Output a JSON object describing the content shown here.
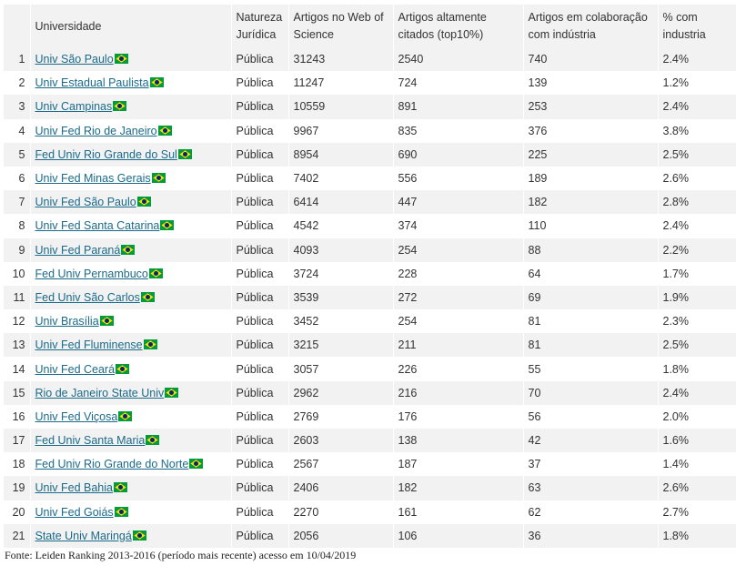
{
  "table": {
    "headers": {
      "rank": "",
      "universidade": "Universidade",
      "natureza": "Natureza Jurídica",
      "artigos_wos": "Artigos no Web of Science",
      "altamente_citados": "Artigos altamente citados (top10%)",
      "colab_industria": "Artigos em colaboração com indústria",
      "pct_industria": "% com industria"
    },
    "rows": [
      {
        "rank": "1",
        "name": "Univ São Paulo",
        "nature": "Pública",
        "wos": "31243",
        "top10": "2540",
        "industry": "740",
        "pct": "2.4%"
      },
      {
        "rank": "2",
        "name": "Univ Estadual Paulista",
        "nature": "Pública",
        "wos": "11247",
        "top10": "724",
        "industry": "139",
        "pct": "1.2%"
      },
      {
        "rank": "3",
        "name": "Univ Campinas",
        "nature": "Pública",
        "wos": "10559",
        "top10": "891",
        "industry": "253",
        "pct": "2.4%"
      },
      {
        "rank": "4",
        "name": "Univ Fed Rio de Janeiro",
        "nature": "Pública",
        "wos": "9967",
        "top10": "835",
        "industry": "376",
        "pct": "3.8%"
      },
      {
        "rank": "5",
        "name": "Fed Univ Rio Grande do Sul",
        "nature": "Pública",
        "wos": "8954",
        "top10": "690",
        "industry": "225",
        "pct": "2.5%"
      },
      {
        "rank": "6",
        "name": "Univ Fed Minas Gerais",
        "nature": "Pública",
        "wos": "7402",
        "top10": "556",
        "industry": "189",
        "pct": "2.6%"
      },
      {
        "rank": "7",
        "name": "Univ Fed São Paulo",
        "nature": "Pública",
        "wos": "6414",
        "top10": "447",
        "industry": "182",
        "pct": "2.8%"
      },
      {
        "rank": "8",
        "name": "Univ Fed Santa Catarina",
        "nature": "Pública",
        "wos": "4542",
        "top10": "374",
        "industry": "110",
        "pct": "2.4%"
      },
      {
        "rank": "9",
        "name": "Univ Fed Paraná",
        "nature": "Pública",
        "wos": "4093",
        "top10": "254",
        "industry": "88",
        "pct": "2.2%"
      },
      {
        "rank": "10",
        "name": "Fed Univ Pernambuco",
        "nature": "Pública",
        "wos": "3724",
        "top10": "228",
        "industry": "64",
        "pct": "1.7%"
      },
      {
        "rank": "11",
        "name": "Fed Univ São Carlos",
        "nature": "Pública",
        "wos": "3539",
        "top10": "272",
        "industry": "69",
        "pct": "1.9%"
      },
      {
        "rank": "12",
        "name": "Univ Brasília",
        "nature": "Pública",
        "wos": "3452",
        "top10": "254",
        "industry": "81",
        "pct": "2.3%"
      },
      {
        "rank": "13",
        "name": "Univ Fed Fluminense",
        "nature": "Pública",
        "wos": "3215",
        "top10": "211",
        "industry": "81",
        "pct": "2.5%"
      },
      {
        "rank": "14",
        "name": "Univ Fed Ceará",
        "nature": "Pública",
        "wos": "3057",
        "top10": "226",
        "industry": "55",
        "pct": "1.8%"
      },
      {
        "rank": "15",
        "name": "Rio de Janeiro State Univ",
        "nature": "Pública",
        "wos": "2962",
        "top10": "216",
        "industry": "70",
        "pct": "2.4%"
      },
      {
        "rank": "16",
        "name": "Univ Fed Viçosa",
        "nature": "Pública",
        "wos": "2769",
        "top10": "176",
        "industry": "56",
        "pct": "2.0%"
      },
      {
        "rank": "17",
        "name": "Fed Univ Santa Maria",
        "nature": "Pública",
        "wos": "2603",
        "top10": "138",
        "industry": "42",
        "pct": "1.6%"
      },
      {
        "rank": "18",
        "name": "Fed Univ Rio Grande do Norte",
        "nature": "Pública",
        "wos": "2567",
        "top10": "187",
        "industry": "37",
        "pct": "1.4%"
      },
      {
        "rank": "19",
        "name": "Univ Fed Bahia",
        "nature": "Pública",
        "wos": "2406",
        "top10": "182",
        "industry": "63",
        "pct": "2.6%"
      },
      {
        "rank": "20",
        "name": "Univ Fed Goiás",
        "nature": "Pública",
        "wos": "2270",
        "top10": "161",
        "industry": "62",
        "pct": "2.7%"
      },
      {
        "rank": "21",
        "name": "State Univ Maringá",
        "nature": "Pública",
        "wos": "2056",
        "top10": "106",
        "industry": "36",
        "pct": "1.8%"
      }
    ],
    "flag_icon": "brazil-flag-icon"
  },
  "source_note": "Fonte: Leiden Ranking 2013-2016 (período mais recente) acesso em 10/04/2019",
  "colors": {
    "link": "#1a6a8a",
    "stripe": "#f2f2f2",
    "flag_green": "#009c3b",
    "flag_yellow": "#ffdf00",
    "flag_blue": "#002776"
  }
}
